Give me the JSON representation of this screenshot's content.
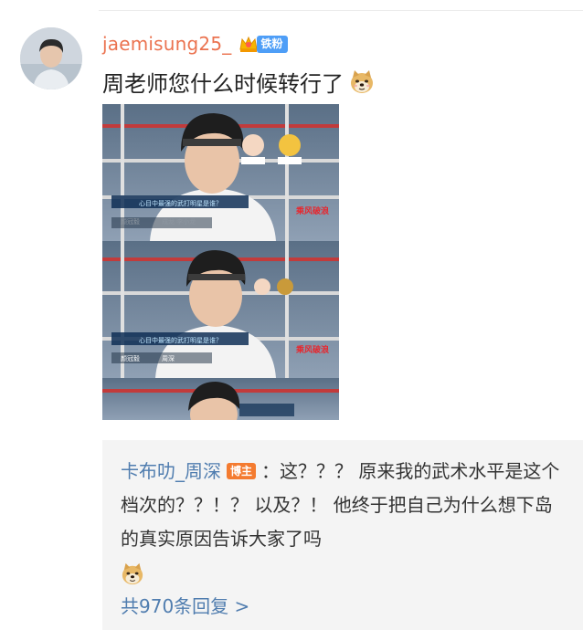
{
  "comment": {
    "username": "jaemisung25_",
    "fan_badge": "铁粉",
    "text": "周老师您什么时候转行了",
    "emoji": "doge-emoji"
  },
  "photo": {
    "panels": [
      {
        "subtitle_question": "心目中最强的武打明星是谁？",
        "guest_label": "颜冠毅",
        "answer": "成龙 李小龙",
        "show_logo": "乘风破浪"
      },
      {
        "subtitle_question": "心目中最强的武打明星是谁？",
        "guest_label": "颜冠毅",
        "answer": "周深",
        "show_logo": "乘风破浪"
      }
    ]
  },
  "reply": {
    "author": "卡布叻_周深",
    "author_badge": "博主",
    "text": "：这？？？ 原来我的武术水平是这个档次的？？！？ 以及？！ 他终于把自己为什么想下岛的真实原因告诉大家了吗",
    "emoji": "doge-emoji",
    "count_text": "共970条回复 >"
  },
  "colors": {
    "username": "#eb7350",
    "link_blue": "#507daf",
    "fan_badge_bg": "#4e9ef7",
    "blogger_badge_bg": "#f47b30",
    "reply_bg": "#f4f4f4"
  }
}
